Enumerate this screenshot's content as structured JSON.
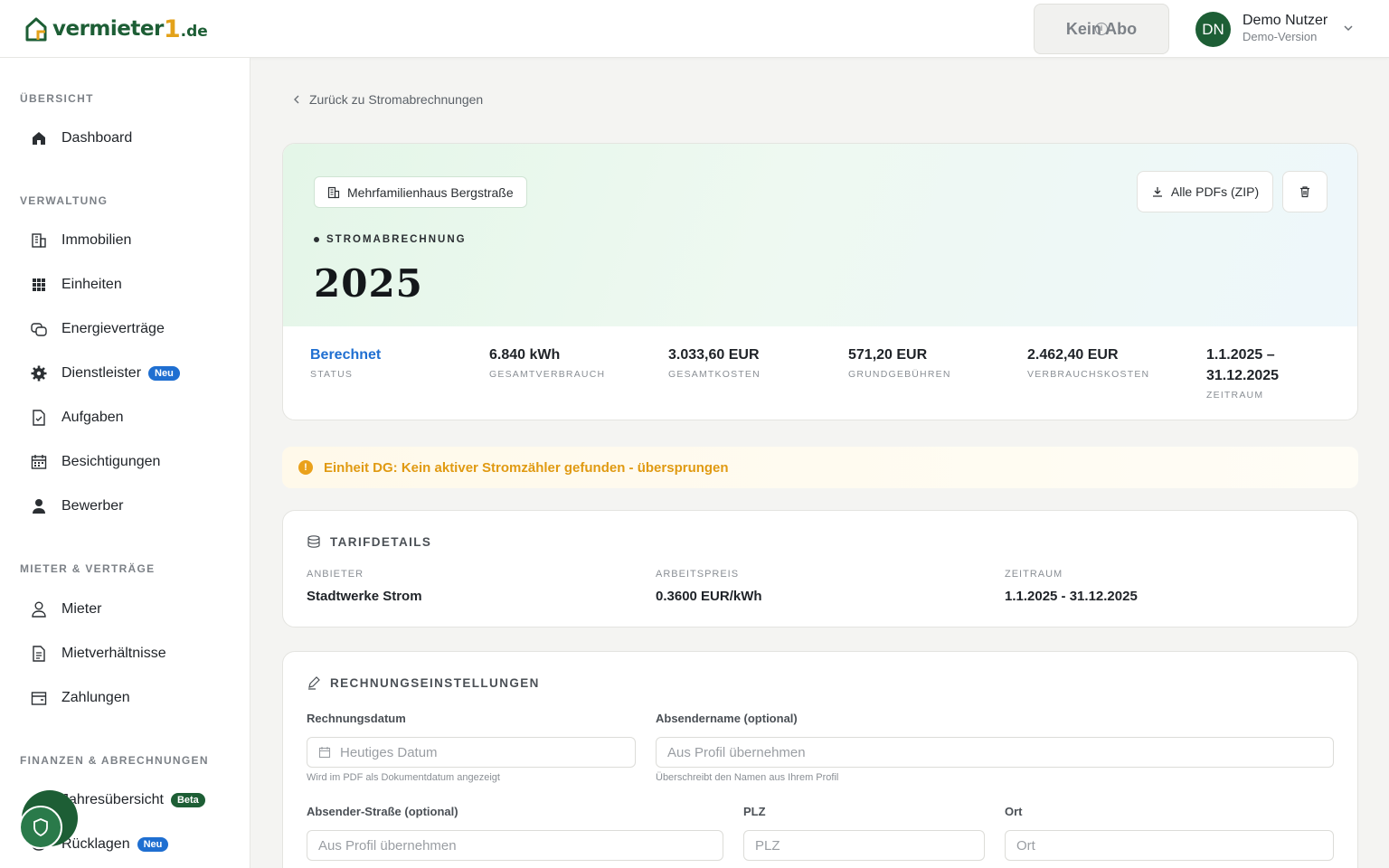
{
  "header": {
    "logo": {
      "text": "vermieter",
      "one": "1",
      "tld": ".de"
    },
    "abo_label": "Kein Abo",
    "user": {
      "initials": "DN",
      "name": "Demo Nutzer",
      "role": "Demo-Version"
    }
  },
  "sidebar": {
    "sections": {
      "overview": "ÜBERSICHT",
      "admin": "VERWALTUNG",
      "tenants": "MIETER & VERTRÄGE",
      "finance": "FINANZEN & ABRECHNUNGEN"
    },
    "items": {
      "dashboard": "Dashboard",
      "immobilien": "Immobilien",
      "einheiten": "Einheiten",
      "energie": "Energieverträge",
      "dienstleister": "Dienstleister",
      "aufgaben": "Aufgaben",
      "besichtigungen": "Besichtigungen",
      "bewerber": "Bewerber",
      "mieter": "Mieter",
      "mietverhaeltnisse": "Mietverhältnisse",
      "zahlungen": "Zahlungen",
      "jahresuebersicht": "Jahresübersicht",
      "ruecklagen": "Rücklagen"
    },
    "badges": {
      "neu": "Neu",
      "beta": "Beta"
    }
  },
  "main": {
    "back_link": "Zurück zu Stromabrechnungen",
    "hero": {
      "property": "Mehrfamilienhaus Bergstraße",
      "zip_button": "Alle PDFs (ZIP)",
      "kicker": "STROMABRECHNUNG",
      "year": "2025",
      "stats": {
        "status": {
          "value": "Berechnet",
          "label": "STATUS"
        },
        "verbrauch": {
          "value": "6.840 kWh",
          "label": "GESAMTVERBRAUCH"
        },
        "kosten": {
          "value": "3.033,60 EUR",
          "label": "GESAMTKOSTEN"
        },
        "grund": {
          "value": "571,20 EUR",
          "label": "GRUNDGEBÜHREN"
        },
        "verbrauchskosten": {
          "value": "2.462,40 EUR",
          "label": "VERBRAUCHSKOSTEN"
        },
        "zeitraum": {
          "value1": "1.1.2025 –",
          "value2": "31.12.2025",
          "label": "ZEITRAUM"
        }
      }
    },
    "warning": "Einheit DG: Kein aktiver Stromzähler gefunden - übersprungen",
    "tarif": {
      "title": "TARIFDETAILS",
      "anbieter": {
        "label": "ANBIETER",
        "value": "Stadtwerke Strom"
      },
      "arbeitspreis": {
        "label": "ARBEITSPREIS",
        "value": "0.3600 EUR/kWh"
      },
      "zeitraum": {
        "label": "ZEITRAUM",
        "value": "1.1.2025 - 31.12.2025"
      }
    },
    "rechnung": {
      "title": "RECHNUNGSEINSTELLUNGEN",
      "datum": {
        "label": "Rechnungsdatum",
        "placeholder": "Heutiges Datum",
        "hint": "Wird im PDF als Dokumentdatum angezeigt"
      },
      "absender": {
        "label": "Absendername (optional)",
        "placeholder": "Aus Profil übernehmen",
        "hint": "Überschreibt den Namen aus Ihrem Profil"
      },
      "strasse": {
        "label": "Absender-Straße (optional)",
        "placeholder": "Aus Profil übernehmen"
      },
      "plz": {
        "label": "PLZ",
        "placeholder": "PLZ"
      },
      "ort": {
        "label": "Ort",
        "placeholder": "Ort"
      }
    }
  }
}
